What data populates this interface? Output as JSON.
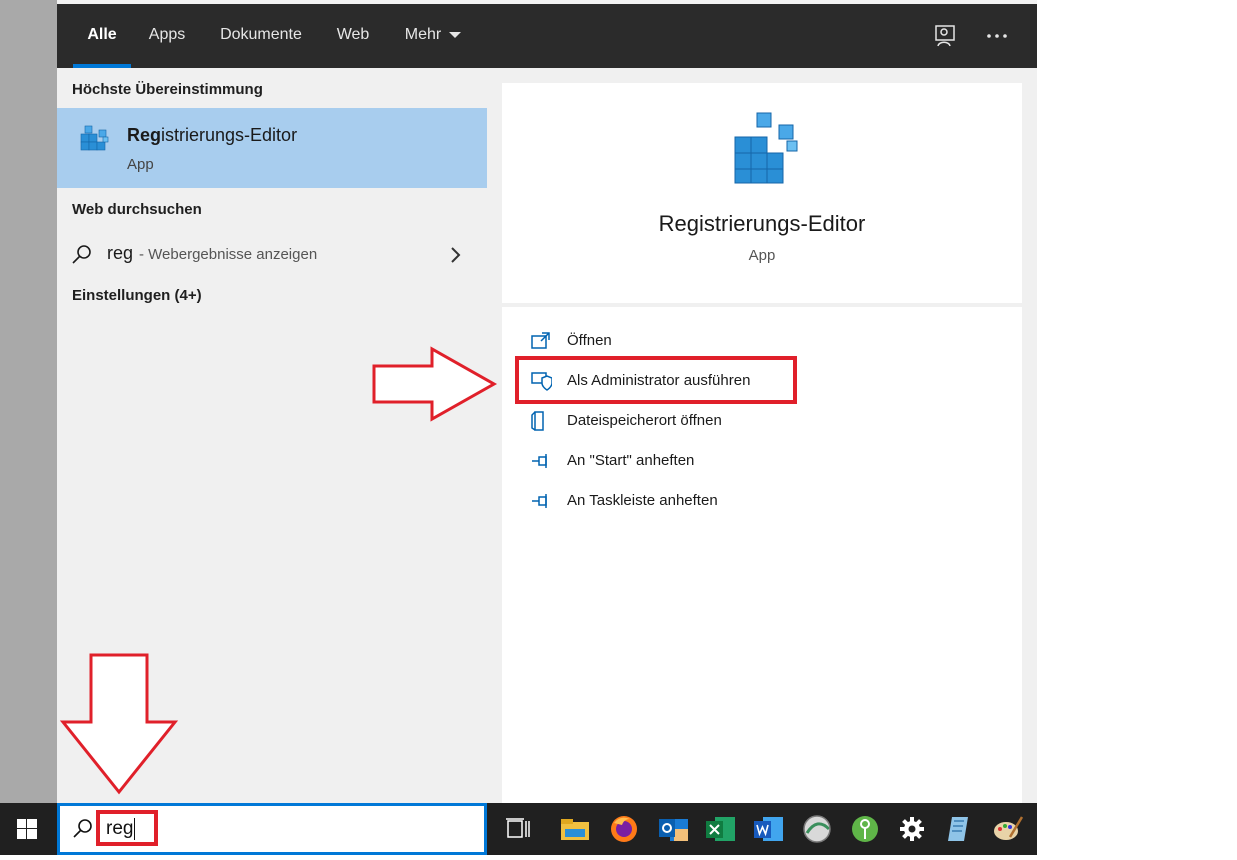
{
  "tabs": [
    {
      "label": "Alle"
    },
    {
      "label": "Apps"
    },
    {
      "label": "Dokumente"
    },
    {
      "label": "Web"
    },
    {
      "label": "Mehr"
    }
  ],
  "left": {
    "best_heading": "Höchste Übereinstimmung",
    "best_title_bold": "Reg",
    "best_title_rest": "istrierungs-Editor",
    "best_sub": "App",
    "web_heading": "Web durchsuchen",
    "web_query": "reg",
    "web_hint": "- Webergebnisse anzeigen",
    "settings_heading": "Einstellungen (4+)"
  },
  "preview": {
    "title": "Registrierungs-Editor",
    "sub": "App"
  },
  "actions": [
    {
      "label": "Öffnen",
      "icon": "open-icon"
    },
    {
      "label": "Als Administrator ausführen",
      "icon": "shield-icon"
    },
    {
      "label": "Dateispeicherort öffnen",
      "icon": "file-location-icon"
    },
    {
      "label": "An \"Start\" anheften",
      "icon": "pin-icon"
    },
    {
      "label": "An Taskleiste anheften",
      "icon": "pin-icon"
    }
  ],
  "search": {
    "value": "reg"
  },
  "colors": {
    "accent": "#0078d7",
    "highlight": "#e0202a",
    "selected": "#a8cdee"
  }
}
